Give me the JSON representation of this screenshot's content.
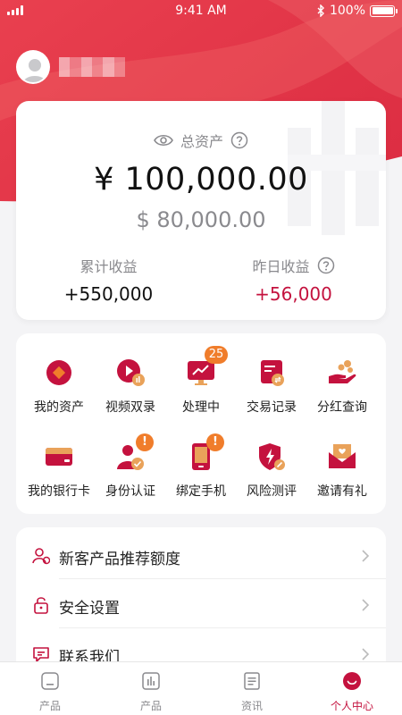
{
  "status_bar": {
    "time": "9:41 AM",
    "battery": "100%"
  },
  "assets": {
    "total_label": "总资产",
    "total_cny": "¥ 100,000.00",
    "total_usd": "$ 80,000.00",
    "cumulative_label": "累计收益",
    "cumulative_value": "+550,000",
    "yesterday_label": "昨日收益",
    "yesterday_value": "+56,000"
  },
  "services": [
    {
      "label": "我的资产",
      "icon": "my-assets-icon"
    },
    {
      "label": "视频双录",
      "icon": "video-record-icon"
    },
    {
      "label": "处理中",
      "icon": "processing-icon",
      "badge": "25"
    },
    {
      "label": "交易记录",
      "icon": "transaction-records-icon"
    },
    {
      "label": "分红查询",
      "icon": "dividend-query-icon"
    },
    {
      "label": "我的银行卡",
      "icon": "bank-card-icon"
    },
    {
      "label": "身份认证",
      "icon": "identity-verification-icon",
      "badge": "!"
    },
    {
      "label": "绑定手机",
      "icon": "bind-phone-icon",
      "badge": "!"
    },
    {
      "label": "风险测评",
      "icon": "risk-assessment-icon"
    },
    {
      "label": "邀请有礼",
      "icon": "invite-gift-icon"
    }
  ],
  "menu": [
    {
      "label": "新客产品推荐额度",
      "icon": "user-quota-icon"
    },
    {
      "label": "安全设置",
      "icon": "lock-icon"
    },
    {
      "label": "联系我们",
      "icon": "chat-icon"
    }
  ],
  "tabs": [
    {
      "label": "产品",
      "icon": "home-icon"
    },
    {
      "label": "产品",
      "icon": "chart-icon"
    },
    {
      "label": "资讯",
      "icon": "news-icon"
    },
    {
      "label": "个人中心",
      "icon": "profile-icon"
    }
  ],
  "colors": {
    "primary": "#c4123e",
    "accent_orange": "#f07d2b",
    "hero_red": "#e8394d"
  }
}
